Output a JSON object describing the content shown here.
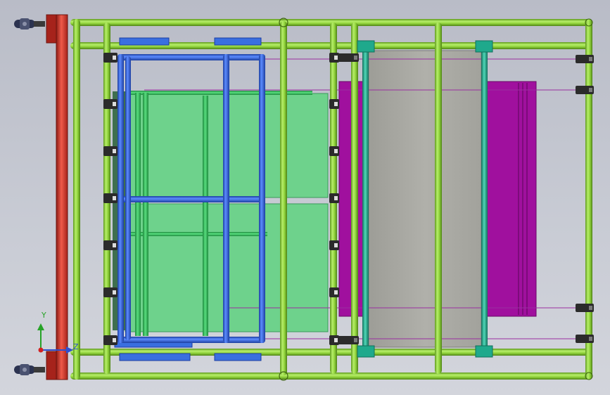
{
  "viewport": {
    "background_top": "#b9bcc7",
    "background_bottom": "#d3d5dc"
  },
  "colors": {
    "frame_tube": "#8fd13a",
    "frame_tube_dark": "#5e9a1c",
    "inner_frame": "#2f5fd6",
    "inner_frame_dark": "#1c3ea0",
    "inner_frame_blue_block": "#3a6fe0",
    "green_panel": "#6ed28c",
    "green_tube": "#2fb85a",
    "green_tube_dark": "#1f8a3e",
    "magenta_panel": "#a0109e",
    "gray_panel": "#a9a9a3",
    "teal_tube": "#1fa98c",
    "teal_tube_dark": "#12705c",
    "red_bar": "#d8362b",
    "red_bar_dark": "#8e1d16",
    "clamp": "#2b2b2b",
    "guide_line": "#9a2ea0",
    "axis_y": "#27a327",
    "axis_z": "#2f4fd0",
    "axis_origin": "#d22222"
  },
  "icons": {
    "caster": "caster-wheel-icon",
    "clamp": "toggle-clamp-icon",
    "triad": "coordinate-triad-icon"
  },
  "triad": {
    "y_label": "Y",
    "z_label": "Z"
  }
}
